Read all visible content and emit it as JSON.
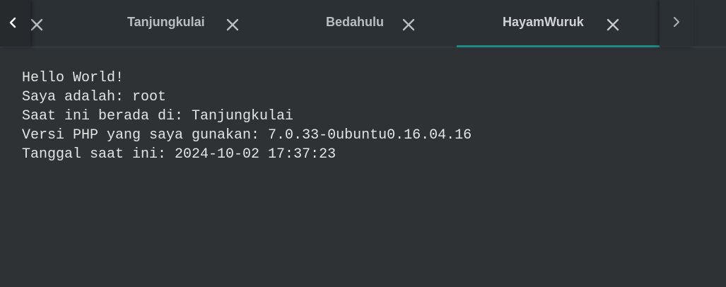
{
  "tabs": [
    {
      "label": "Tanjungkulai",
      "active": false
    },
    {
      "label": "Bedahulu",
      "active": false
    },
    {
      "label": "HayamWuruk",
      "active": true
    }
  ],
  "icons": {
    "scroll_left": "chevron-left-icon",
    "scroll_right": "chevron-right-icon",
    "close": "close-icon"
  },
  "colors": {
    "background": "#2e3235",
    "tabbar": "#2b3034",
    "active_indicator": "#1e8a86",
    "text": "#e2e4e5"
  },
  "terminal": {
    "lines": [
      "Hello World!",
      "Saya adalah: root",
      "Saat ini berada di: Tanjungkulai",
      "Versi PHP yang saya gunakan: 7.0.33-0ubuntu0.16.04.16",
      "Tanggal saat ini: 2024-10-02 17:37:23"
    ]
  }
}
